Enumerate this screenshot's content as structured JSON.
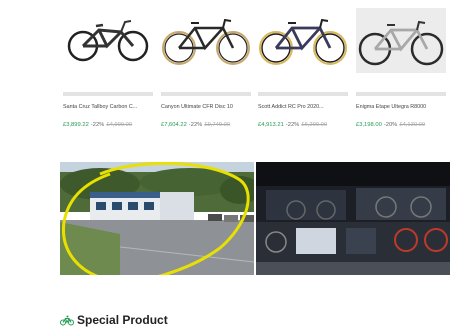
{
  "products": [
    {
      "title": "Santa Cruz Tallboy Carbon C...",
      "price": "£3,899.22",
      "discount": "-22%",
      "was": "£4,999.00"
    },
    {
      "title": "Canyon Ultimate CFR Disc 10",
      "price": "£7,604.22",
      "discount": "-22%",
      "was": "£9,749.00"
    },
    {
      "title": "Scott Addict RC Pro 2020...",
      "price": "£4,913.21",
      "discount": "-22%",
      "was": "£6,299.00"
    },
    {
      "title": "Enigma Etape Ultegra R8000",
      "price": "£3,198.00",
      "discount": "-20%",
      "was": "£4,130.00"
    }
  ],
  "photos": [
    {
      "icon": "building-exterior-photo",
      "annotation": "yellow-hand-drawn-circle"
    },
    {
      "icon": "shop-interior-photo"
    }
  ],
  "section": {
    "title": "Special Product",
    "icon": "bicycle-icon",
    "accent": "#1e9c4f"
  },
  "colors": {
    "price": "#1e9c4f",
    "strikethrough": "#aaaaaa",
    "annotation": "#e8e000"
  }
}
